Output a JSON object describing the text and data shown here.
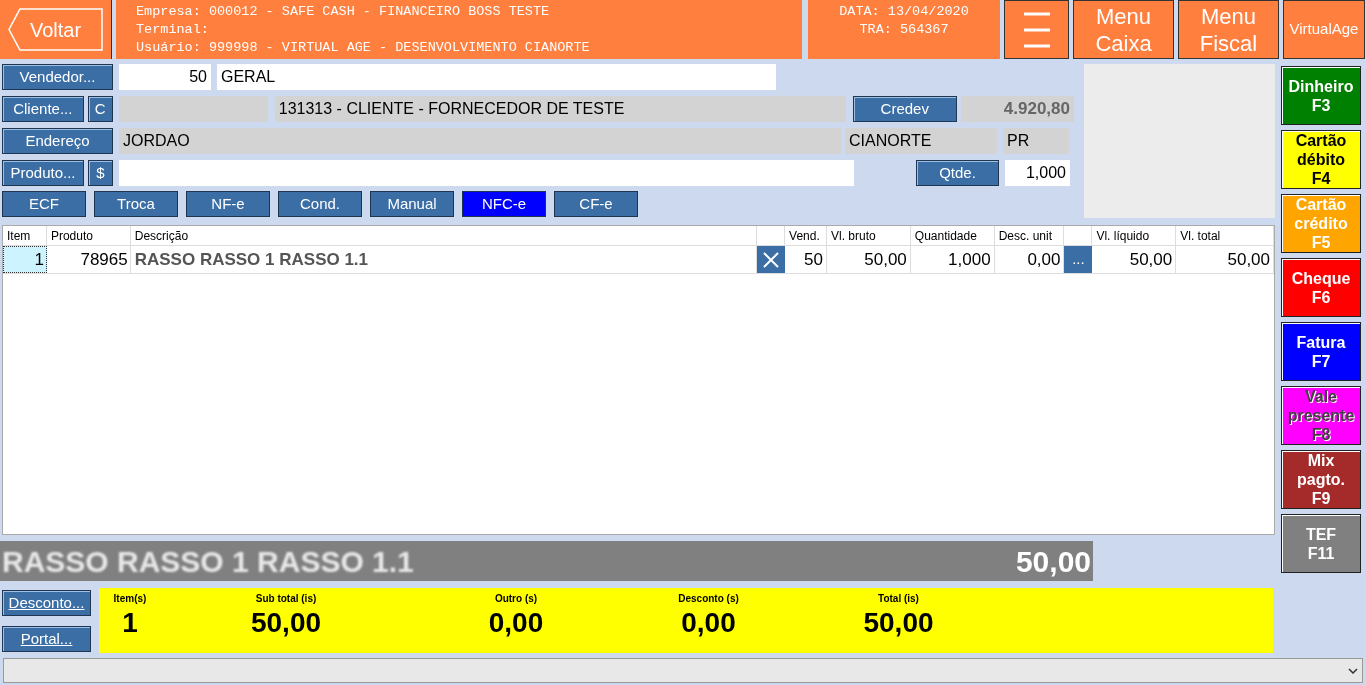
{
  "header": {
    "back_button": "Voltar",
    "info_lines": [
      "Empresa: 000012 - SAFE CASH - FINANCEIRO BOSS TESTE",
      "Terminal:",
      "Usuário: 999998 - VIRTUAL AGE - DESENVOLVIMENTO CIANORTE"
    ],
    "date_lines": [
      "DATA: 13/04/2020",
      "TRA: 564367"
    ],
    "menu_buttons": [
      [
        "Menu",
        "Caixa"
      ],
      [
        "Menu",
        "Fiscal"
      ]
    ],
    "brand": "VirtualAge"
  },
  "seller": {
    "button": "Vendedor...",
    "code": "50",
    "name": "GERAL"
  },
  "client": {
    "button": "Cliente...",
    "c_button": "C",
    "name": "131313 - CLIENTE - FORNECEDOR DE TESTE",
    "credev_button": "Credev",
    "balance": "4.920,80"
  },
  "address": {
    "button": "Endereço",
    "street": "JORDAO",
    "city": "CIANORTE",
    "state": "PR"
  },
  "product": {
    "button": "Produto...",
    "price_button": "$",
    "qty_button": "Qtde.",
    "qty": "1,000"
  },
  "modes": [
    {
      "label": "ECF",
      "selected": false
    },
    {
      "label": "Troca",
      "selected": false
    },
    {
      "label": "NF-e",
      "selected": false
    },
    {
      "label": "Cond.",
      "selected": false
    },
    {
      "label": "Manual",
      "selected": false
    },
    {
      "label": "NFC-e",
      "selected": true
    },
    {
      "label": "CF-e",
      "selected": false
    }
  ],
  "table": {
    "columns": [
      "Item",
      "Produto",
      "Descrição",
      "",
      "Vend.",
      "Vl. bruto",
      "Quantidade",
      "Desc. unit",
      "",
      "Vl. líquido",
      "Vl. total"
    ],
    "rows": [
      {
        "item": "1",
        "produto": "78965",
        "descricao": "RASSO RASSO 1 RASSO 1.1",
        "vend": "50",
        "bruto": "50,00",
        "quantidade": "1,000",
        "desconto": "0,00",
        "more": "...",
        "liquido": "50,00",
        "total": "50,00"
      }
    ]
  },
  "current_item": {
    "description": "RASSO RASSO 1 RASSO 1.1",
    "value": "50,00"
  },
  "side_buttons": [
    "Desconto...",
    "Portal..."
  ],
  "totals": [
    {
      "label": "Item(s)",
      "value": "1"
    },
    {
      "label": "Sub total (is)",
      "value": "50,00"
    },
    {
      "label": "Outro (s)",
      "value": "0,00"
    },
    {
      "label": "Desconto (s)",
      "value": "0,00"
    },
    {
      "label": "Total (is)",
      "value": "50,00"
    }
  ],
  "payments": [
    {
      "lines": [
        "Dinheiro",
        "F3"
      ],
      "color": "#008000",
      "disabled": false
    },
    {
      "lines": [
        "Cartão",
        "débito",
        "F4"
      ],
      "color": "#ffff00",
      "disabled": false
    },
    {
      "lines": [
        "Cartão",
        "crédito",
        "F5"
      ],
      "color": "#ffa500",
      "disabled": false
    },
    {
      "lines": [
        "Cheque",
        "F6"
      ],
      "color": "#ff0000",
      "disabled": false
    },
    {
      "lines": [
        "Fatura",
        "F7"
      ],
      "color": "#0000ff",
      "disabled": false
    },
    {
      "lines": [
        "Vale",
        "presente",
        "F8"
      ],
      "color": "#ff00ff",
      "disabled": true
    },
    {
      "lines": [
        "Mix",
        "pagto.",
        "F9"
      ],
      "color": "#a52a2a",
      "disabled": false
    },
    {
      "lines": [
        "TEF",
        "F11"
      ],
      "color": "#808080",
      "disabled": false
    }
  ]
}
